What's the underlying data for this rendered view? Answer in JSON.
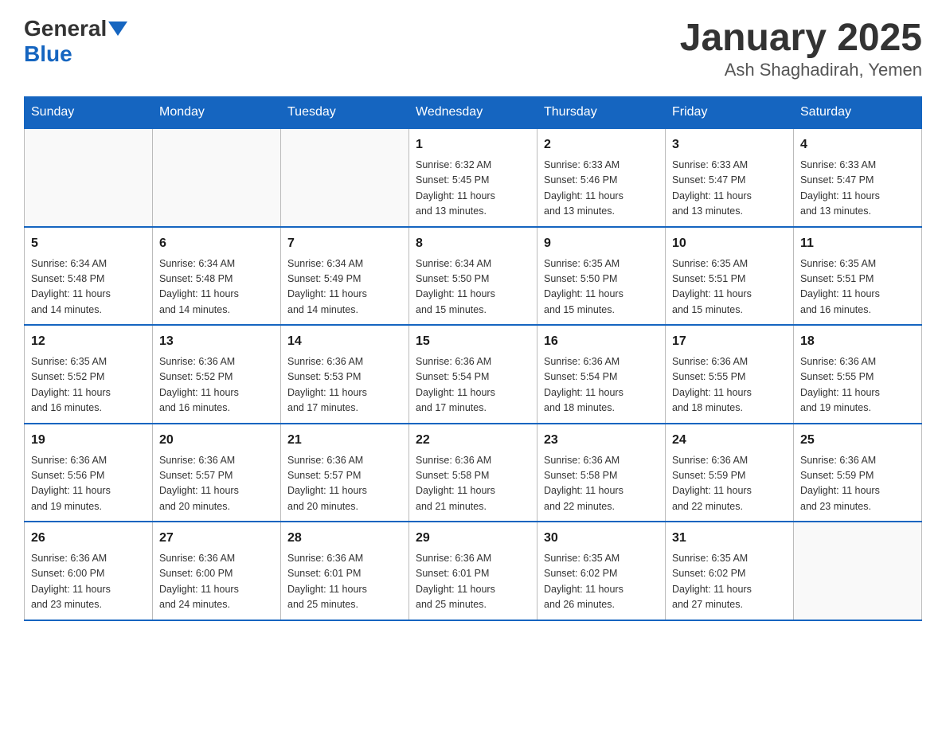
{
  "header": {
    "logo_text": "General",
    "logo_blue": "Blue",
    "month_title": "January 2025",
    "location": "Ash Shaghadirah, Yemen"
  },
  "days_of_week": [
    "Sunday",
    "Monday",
    "Tuesday",
    "Wednesday",
    "Thursday",
    "Friday",
    "Saturday"
  ],
  "weeks": [
    [
      {
        "day": "",
        "info": ""
      },
      {
        "day": "",
        "info": ""
      },
      {
        "day": "",
        "info": ""
      },
      {
        "day": "1",
        "info": "Sunrise: 6:32 AM\nSunset: 5:45 PM\nDaylight: 11 hours\nand 13 minutes."
      },
      {
        "day": "2",
        "info": "Sunrise: 6:33 AM\nSunset: 5:46 PM\nDaylight: 11 hours\nand 13 minutes."
      },
      {
        "day": "3",
        "info": "Sunrise: 6:33 AM\nSunset: 5:47 PM\nDaylight: 11 hours\nand 13 minutes."
      },
      {
        "day": "4",
        "info": "Sunrise: 6:33 AM\nSunset: 5:47 PM\nDaylight: 11 hours\nand 13 minutes."
      }
    ],
    [
      {
        "day": "5",
        "info": "Sunrise: 6:34 AM\nSunset: 5:48 PM\nDaylight: 11 hours\nand 14 minutes."
      },
      {
        "day": "6",
        "info": "Sunrise: 6:34 AM\nSunset: 5:48 PM\nDaylight: 11 hours\nand 14 minutes."
      },
      {
        "day": "7",
        "info": "Sunrise: 6:34 AM\nSunset: 5:49 PM\nDaylight: 11 hours\nand 14 minutes."
      },
      {
        "day": "8",
        "info": "Sunrise: 6:34 AM\nSunset: 5:50 PM\nDaylight: 11 hours\nand 15 minutes."
      },
      {
        "day": "9",
        "info": "Sunrise: 6:35 AM\nSunset: 5:50 PM\nDaylight: 11 hours\nand 15 minutes."
      },
      {
        "day": "10",
        "info": "Sunrise: 6:35 AM\nSunset: 5:51 PM\nDaylight: 11 hours\nand 15 minutes."
      },
      {
        "day": "11",
        "info": "Sunrise: 6:35 AM\nSunset: 5:51 PM\nDaylight: 11 hours\nand 16 minutes."
      }
    ],
    [
      {
        "day": "12",
        "info": "Sunrise: 6:35 AM\nSunset: 5:52 PM\nDaylight: 11 hours\nand 16 minutes."
      },
      {
        "day": "13",
        "info": "Sunrise: 6:36 AM\nSunset: 5:52 PM\nDaylight: 11 hours\nand 16 minutes."
      },
      {
        "day": "14",
        "info": "Sunrise: 6:36 AM\nSunset: 5:53 PM\nDaylight: 11 hours\nand 17 minutes."
      },
      {
        "day": "15",
        "info": "Sunrise: 6:36 AM\nSunset: 5:54 PM\nDaylight: 11 hours\nand 17 minutes."
      },
      {
        "day": "16",
        "info": "Sunrise: 6:36 AM\nSunset: 5:54 PM\nDaylight: 11 hours\nand 18 minutes."
      },
      {
        "day": "17",
        "info": "Sunrise: 6:36 AM\nSunset: 5:55 PM\nDaylight: 11 hours\nand 18 minutes."
      },
      {
        "day": "18",
        "info": "Sunrise: 6:36 AM\nSunset: 5:55 PM\nDaylight: 11 hours\nand 19 minutes."
      }
    ],
    [
      {
        "day": "19",
        "info": "Sunrise: 6:36 AM\nSunset: 5:56 PM\nDaylight: 11 hours\nand 19 minutes."
      },
      {
        "day": "20",
        "info": "Sunrise: 6:36 AM\nSunset: 5:57 PM\nDaylight: 11 hours\nand 20 minutes."
      },
      {
        "day": "21",
        "info": "Sunrise: 6:36 AM\nSunset: 5:57 PM\nDaylight: 11 hours\nand 20 minutes."
      },
      {
        "day": "22",
        "info": "Sunrise: 6:36 AM\nSunset: 5:58 PM\nDaylight: 11 hours\nand 21 minutes."
      },
      {
        "day": "23",
        "info": "Sunrise: 6:36 AM\nSunset: 5:58 PM\nDaylight: 11 hours\nand 22 minutes."
      },
      {
        "day": "24",
        "info": "Sunrise: 6:36 AM\nSunset: 5:59 PM\nDaylight: 11 hours\nand 22 minutes."
      },
      {
        "day": "25",
        "info": "Sunrise: 6:36 AM\nSunset: 5:59 PM\nDaylight: 11 hours\nand 23 minutes."
      }
    ],
    [
      {
        "day": "26",
        "info": "Sunrise: 6:36 AM\nSunset: 6:00 PM\nDaylight: 11 hours\nand 23 minutes."
      },
      {
        "day": "27",
        "info": "Sunrise: 6:36 AM\nSunset: 6:00 PM\nDaylight: 11 hours\nand 24 minutes."
      },
      {
        "day": "28",
        "info": "Sunrise: 6:36 AM\nSunset: 6:01 PM\nDaylight: 11 hours\nand 25 minutes."
      },
      {
        "day": "29",
        "info": "Sunrise: 6:36 AM\nSunset: 6:01 PM\nDaylight: 11 hours\nand 25 minutes."
      },
      {
        "day": "30",
        "info": "Sunrise: 6:35 AM\nSunset: 6:02 PM\nDaylight: 11 hours\nand 26 minutes."
      },
      {
        "day": "31",
        "info": "Sunrise: 6:35 AM\nSunset: 6:02 PM\nDaylight: 11 hours\nand 27 minutes."
      },
      {
        "day": "",
        "info": ""
      }
    ]
  ]
}
